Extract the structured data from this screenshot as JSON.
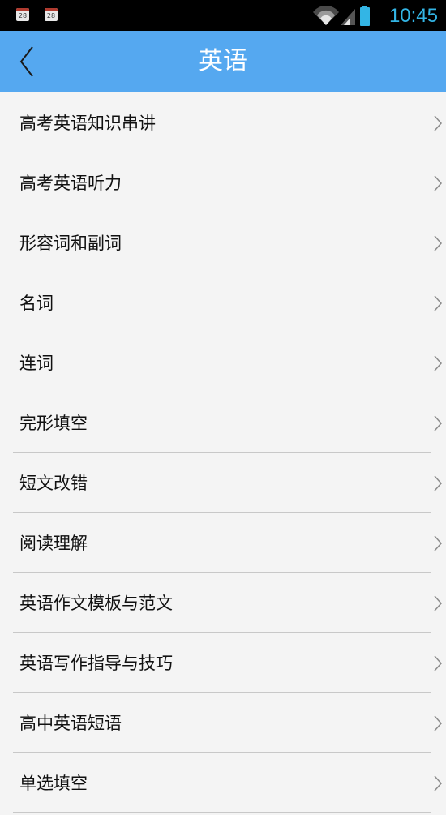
{
  "status_bar": {
    "notification_icons": [
      {
        "icon": "calendar-icon",
        "text": "28"
      },
      {
        "icon": "calendar-icon",
        "text": "28"
      }
    ],
    "icons": [
      "wifi-icon",
      "signal-icon",
      "battery-icon"
    ],
    "time": "10:45",
    "accent_color": "#33b5e5"
  },
  "app_bar": {
    "title": "英语",
    "back_icon": "back-arrow-icon",
    "background_color": "#55a8f0"
  },
  "menu": {
    "items": [
      {
        "label": "高考英语知识串讲"
      },
      {
        "label": "高考英语听力"
      },
      {
        "label": "形容词和副词"
      },
      {
        "label": "名词"
      },
      {
        "label": "连词"
      },
      {
        "label": "完形填空"
      },
      {
        "label": "短文改错"
      },
      {
        "label": "阅读理解"
      },
      {
        "label": "英语作文模板与范文"
      },
      {
        "label": "英语写作指导与技巧"
      },
      {
        "label": "高中英语短语"
      },
      {
        "label": "单选填空"
      }
    ],
    "item_icon": "chevron-right-icon"
  }
}
